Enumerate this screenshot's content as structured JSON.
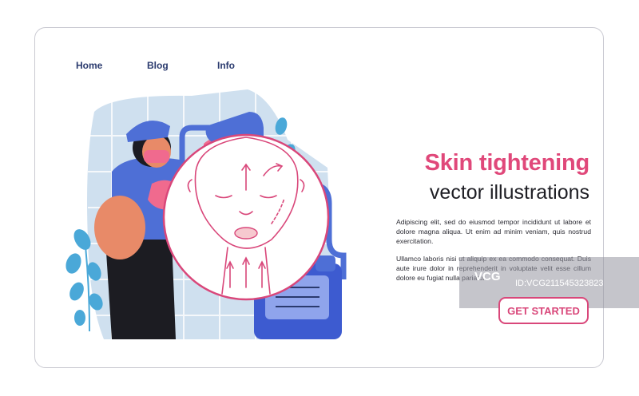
{
  "nav": {
    "items": [
      "Home",
      "Blog",
      "Info"
    ]
  },
  "hero": {
    "title_line1": "Skin tightening",
    "title_line2": "vector illustrations",
    "paragraph1": "Adipiscing elit, sed do eiusmod tempor incididunt ut labore et dolore magna aliqua. Ut enim ad minim veniam, quis nostrud exercitation.",
    "paragraph2": "Ullamco laboris nisi ut aliquip ex ea commodo consequat. Duis aute irure dolor in reprehenderit in voluptate velit esse cillum dolore eu fugiat nulla pariatur.",
    "cta_label": "GET STARTED"
  },
  "watermark": {
    "logo": "VCG",
    "text": "ID:VCG211545323823"
  },
  "colors": {
    "accent": "#e0487a",
    "nav": "#2a3a6e",
    "bg_tile": "#cfe0ef",
    "leaf": "#4aa8d8",
    "shirt": "#4e6fd6",
    "skin": "#e88a68"
  }
}
